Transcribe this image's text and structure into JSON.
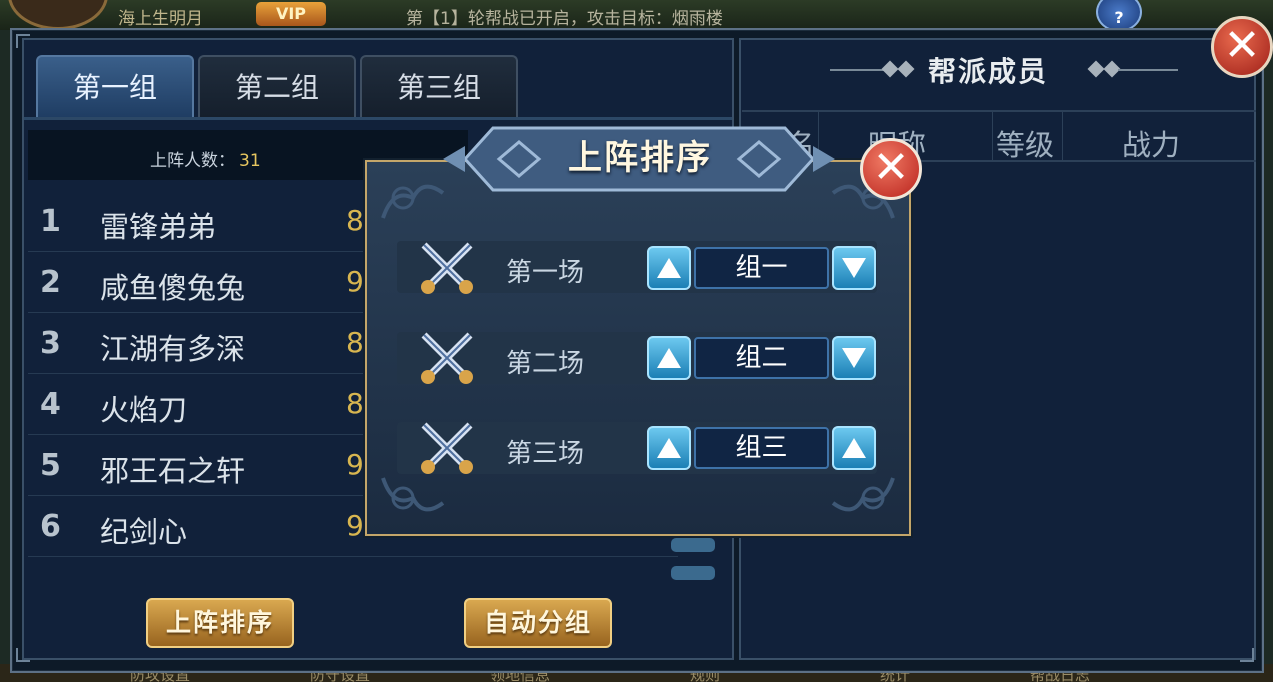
{
  "topbar": {
    "player_name": "海上生明月",
    "vip_label": "VIP",
    "notice": "第【1】轮帮战已开启，攻击目标：烟雨楼",
    "help_label": "?"
  },
  "bottombar": {
    "items": [
      "防攻设置",
      "防守设置",
      "领地信息",
      "规则",
      "统计",
      "帮战日志"
    ]
  },
  "left_panel": {
    "tabs": [
      {
        "label": "第一组",
        "active": true
      },
      {
        "label": "第二组",
        "active": false
      },
      {
        "label": "第三组",
        "active": false
      }
    ],
    "count_label": "上阵人数：",
    "count_value": "31",
    "members": [
      {
        "rank": "1",
        "name": "雷锋弟弟",
        "level": "8"
      },
      {
        "rank": "2",
        "name": "咸鱼傻兔兔",
        "level": "9"
      },
      {
        "rank": "3",
        "name": "江湖有多深",
        "level": "8"
      },
      {
        "rank": "4",
        "name": "火焰刀",
        "level": "8"
      },
      {
        "rank": "5",
        "name": "邪王石之轩",
        "level": "9"
      },
      {
        "rank": "6",
        "name": "纪剑心",
        "level": "9"
      }
    ],
    "order_button": "上阵排序",
    "auto_group_button": "自动分组"
  },
  "right_panel": {
    "title": "帮派成员",
    "columns": [
      "名",
      "昵称",
      "等级",
      "战力"
    ]
  },
  "dialog": {
    "title": "上阵排序",
    "close_label": "✕",
    "matches": [
      {
        "label": "第一场",
        "group": "组一",
        "up": "▲",
        "down": "▼"
      },
      {
        "label": "第二场",
        "group": "组二",
        "up": "▲",
        "down": "▼"
      },
      {
        "label": "第三场",
        "group": "组三",
        "up": "▲",
        "down": "▲"
      }
    ]
  },
  "close_main_label": "✕",
  "colors": {
    "panel_bg": "#11213a",
    "accent_gold": "#d9a850",
    "active_tab": "#3a5f8a",
    "arrow_blue": "#1b7fb5",
    "close_red": "#b9231d"
  }
}
